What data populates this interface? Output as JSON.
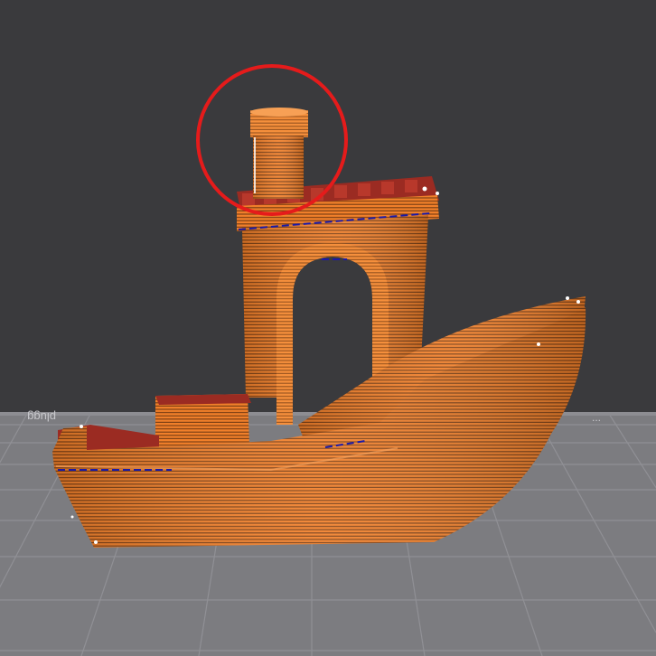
{
  "viewport": {
    "background_color": "#3a3a3d",
    "bed_color": "#7c7c80",
    "bed_grid_color": "#909095"
  },
  "bed": {
    "edge_text_left": "plugg",
    "edge_text_right": "..."
  },
  "model": {
    "filament_color": "#f07f2a",
    "layer_line_color": "#6a3510",
    "deck_color": "#9b2b22",
    "seam_color": "#1a1aa8",
    "highlight_color": "#ffffff"
  },
  "annotation": {
    "circle_color": "#e51b1b"
  }
}
